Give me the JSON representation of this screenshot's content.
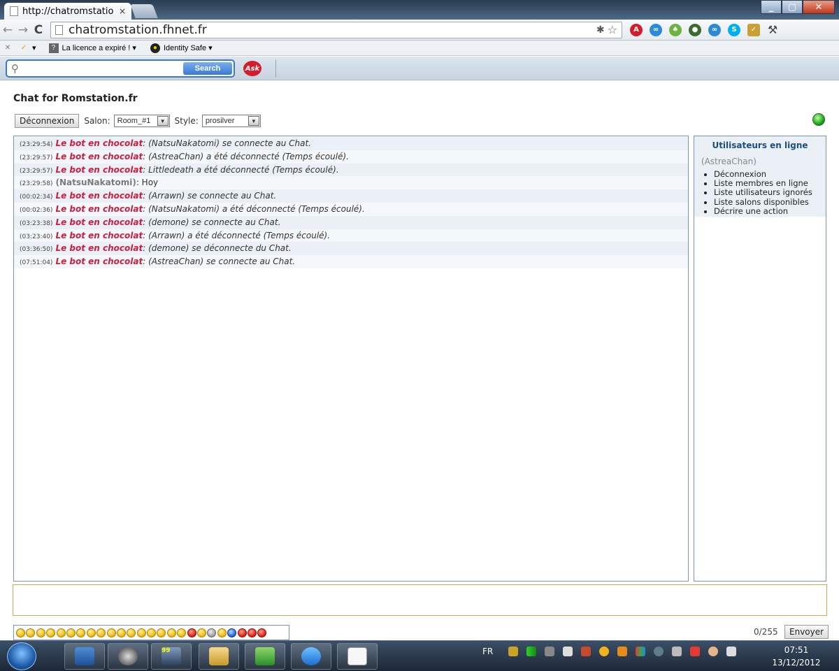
{
  "browser": {
    "tab_title": "http://chatromstatio",
    "tab_close": "×",
    "url": "chatromstation.fhnet.fr",
    "bookmarks": [
      {
        "label": "La licence a expiré ! ▾"
      },
      {
        "label": "Identity Safe ▾"
      }
    ]
  },
  "askbar": {
    "search_label": "Search",
    "logo_text": "Ask"
  },
  "page": {
    "title": "Chat for Romstation.fr",
    "logout_label": "Déconnexion",
    "room_label": "Salon:",
    "room_value": "Room_#1",
    "style_label": "Style:",
    "style_value": "prosilver"
  },
  "messages": [
    {
      "time": "(23:29:54)",
      "author": "Le bot en chocolat",
      "kind": "bot",
      "text": ": (NatsuNakatomi) se connecte au Chat."
    },
    {
      "time": "(23:29:57)",
      "author": "Le bot en chocolat",
      "kind": "bot",
      "text": ": (AstreaChan) a été déconnecté (Temps écoulé)."
    },
    {
      "time": "(23:29:57)",
      "author": "Le bot en chocolat",
      "kind": "bot",
      "text": ": Littledeath a été déconnecté (Temps écoulé)."
    },
    {
      "time": "(23:29:58)",
      "author": "(NatsuNakatomi)",
      "kind": "user",
      "text": ": Hoy"
    },
    {
      "time": "(00:02:34)",
      "author": "Le bot en chocolat",
      "kind": "bot",
      "text": ": (Arrawn) se connecte au Chat."
    },
    {
      "time": "(00:02:36)",
      "author": "Le bot en chocolat",
      "kind": "bot",
      "text": ": (NatsuNakatomi) a été déconnecté (Temps écoulé)."
    },
    {
      "time": "(03:23:38)",
      "author": "Le bot en chocolat",
      "kind": "bot",
      "text": ": (demone) se connecte au Chat."
    },
    {
      "time": "(03:23:40)",
      "author": "Le bot en chocolat",
      "kind": "bot",
      "text": ": (Arrawn) a été déconnecté (Temps écoulé)."
    },
    {
      "time": "(03:36:50)",
      "author": "Le bot en chocolat",
      "kind": "bot",
      "text": ": (demone) se déconnecte du Chat."
    },
    {
      "time": "(07:51:04)",
      "author": "Le bot en chocolat",
      "kind": "bot",
      "text": ": (AstreaChan) se connecte au Chat."
    }
  ],
  "online": {
    "title": "Utilisateurs en ligne",
    "user": "(AstreaChan)",
    "items": [
      "Déconnexion",
      "Liste membres en ligne",
      "Liste utilisateurs ignorés",
      "Liste salons disponibles",
      "Décrire une action"
    ]
  },
  "composer": {
    "char_count": "0/255",
    "send_label": "Envoyer"
  },
  "taskbar": {
    "language": "FR",
    "time": "07:51",
    "date": "13/12/2012",
    "badge": "99"
  },
  "colors": {
    "bot_name": "#cf1d3d",
    "panel_title": "#1a4f84",
    "border": "#7a95b3"
  }
}
